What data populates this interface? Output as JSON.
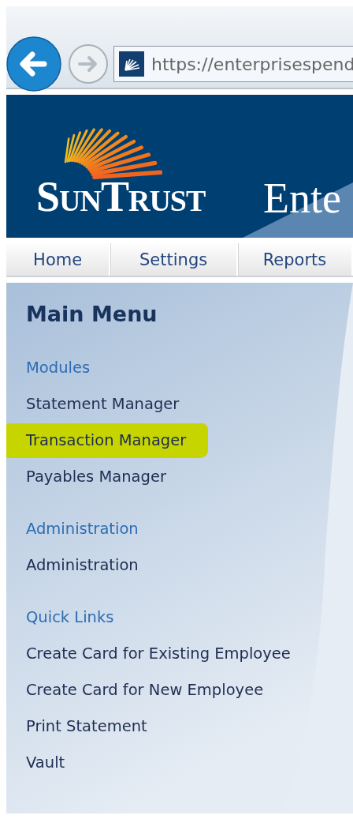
{
  "browser": {
    "url": "https://enterprisespend"
  },
  "banner": {
    "brand": "SunTrust",
    "title": "Ente"
  },
  "nav": [
    {
      "label": "Home"
    },
    {
      "label": "Settings"
    },
    {
      "label": "Reports"
    }
  ],
  "sidebar": {
    "title": "Main Menu",
    "sections": [
      {
        "heading": "Modules",
        "items": [
          {
            "label": "Statement Manager",
            "highlighted": false
          },
          {
            "label": "Transaction Manager",
            "highlighted": true
          },
          {
            "label": "Payables Manager",
            "highlighted": false
          }
        ]
      },
      {
        "heading": "Administration",
        "items": [
          {
            "label": "Administration",
            "highlighted": false
          }
        ]
      },
      {
        "heading": "Quick Links",
        "items": [
          {
            "label": "Create Card for Existing Employee",
            "highlighted": false
          },
          {
            "label": "Create Card for New Employee",
            "highlighted": false
          },
          {
            "label": "Print Statement",
            "highlighted": false
          },
          {
            "label": "Vault",
            "highlighted": false
          }
        ]
      }
    ]
  }
}
